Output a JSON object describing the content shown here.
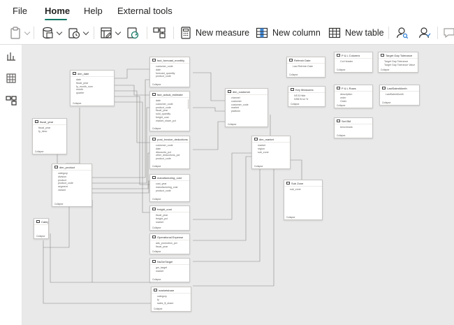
{
  "menu": {
    "file": "File",
    "home": "Home",
    "help": "Help",
    "external_tools": "External tools"
  },
  "ribbon": {
    "new_measure": "New measure",
    "new_column": "New column",
    "new_table": "New table"
  },
  "tables": {
    "dim_date": {
      "name": "dim_date",
      "cols": [
        "date",
        "fiscal_year",
        "fy_month_num",
        "month",
        "quarter"
      ],
      "foot": "Collapse"
    },
    "fiscal_year": {
      "name": "fiscal_year",
      "cols": [
        "fiscal_year",
        "fy_desc"
      ],
      "foot": "Collapse"
    },
    "dim_product": {
      "name": "dim_product",
      "cols": [
        "category",
        "division",
        "product",
        "product_code",
        "segment",
        "variant"
      ],
      "foot": "Collapse"
    },
    "category": {
      "name": "Category",
      "cols": [],
      "foot": "Collapse"
    },
    "fact_forecast_monthly": {
      "name": "fact_forecast_monthly",
      "cols": [
        "customer_code",
        "date",
        "forecast_quantity",
        "product_code"
      ],
      "foot": "Collapse"
    },
    "fact_actual_estimate": {
      "name": "fact_actual_estimate",
      "cols": [
        "date",
        "customer_code",
        "product_code",
        "fiscal_year",
        "sold_quantity",
        "freight_cost",
        "market_share_pct"
      ],
      "foot": "Collapse"
    },
    "post_invoice": {
      "name": "post_invoice_deductions",
      "cols": [
        "customer_code",
        "date",
        "discounts_pct",
        "other_deductions_pct",
        "product_code"
      ],
      "foot": "Collapse"
    },
    "manufacturing": {
      "name": "manufacturing_cost",
      "cols": [
        "cost_year",
        "manufacturing_cost",
        "product_code"
      ],
      "foot": "Collapse"
    },
    "freight": {
      "name": "freight_cost",
      "cols": [
        "fiscal_year",
        "freight_pct",
        "market"
      ],
      "foot": "Collapse"
    },
    "opex": {
      "name": "Operational Expense",
      "cols": [
        "ads_promotion_pct",
        "fiscal_year"
      ],
      "foot": "Collapse"
    },
    "netsales_target": {
      "name": "NsGmTarget",
      "cols": [
        "gm_target",
        "market"
      ],
      "foot": "Collapse"
    },
    "marketshare": {
      "name": "marketshare",
      "cols": [
        "category",
        "fy",
        "sales_$_share"
      ],
      "foot": "Collapse"
    },
    "dim_customer": {
      "name": "dim_customer",
      "cols": [
        "channel",
        "customer",
        "customer_code",
        "market",
        "platform"
      ],
      "foot": "Collapse"
    },
    "dim_market": {
      "name": "dim_market",
      "cols": [
        "market",
        "region",
        "sub_zone"
      ],
      "foot": "Collapse"
    },
    "subzone": {
      "name": "Sub Zone",
      "cols": [
        "sub_zone"
      ],
      "foot": "Collapse"
    },
    "refresh_date": {
      "name": "Refresh Date",
      "cols": [
        "Last Refresh Date"
      ],
      "foot": "Collapse"
    },
    "key_measures": {
      "name": "Key Measures",
      "cols": [
        "NS $ Hide",
        "NS$ Error %"
      ],
      "foot": "Collapse"
    },
    "pl_columns": {
      "name": "P & L Columns",
      "cols": [
        "Col Header"
      ],
      "foot": "Collapse"
    },
    "pl_rows": {
      "name": "P & L Rows",
      "cols": [
        "description",
        "order",
        "Order"
      ],
      "foot": "Collapse"
    },
    "set_bm": {
      "name": "Set BM",
      "cols": [
        "benchmark"
      ],
      "foot": "Collapse"
    },
    "target_gap": {
      "name": "Target Gap Tolerance",
      "cols": [
        "Target Gap Tolerance",
        "Target Gap Tolerance Value"
      ],
      "foot": "Collapse"
    },
    "last_sales": {
      "name": "LastSalesMonth",
      "cols": [
        "LastSalesMonth"
      ],
      "foot": "Collapse"
    }
  }
}
